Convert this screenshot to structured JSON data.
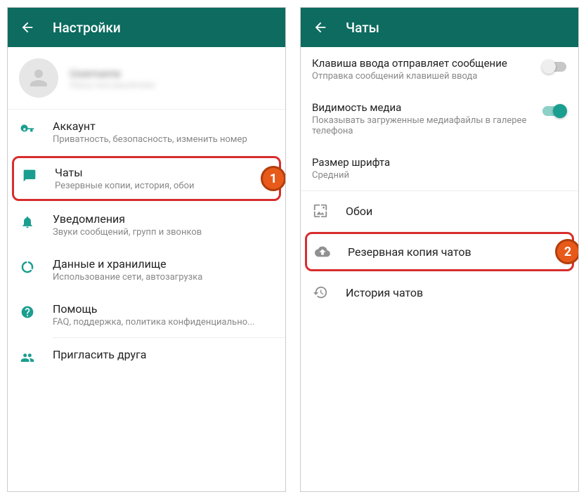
{
  "left": {
    "appbar_title": "Настройки",
    "profile": {
      "name": "Username",
      "status": "Status text placeholder"
    },
    "items": {
      "account": {
        "title": "Аккаунт",
        "sub": "Приватность, безопасность, изменить номер"
      },
      "chats": {
        "title": "Чаты",
        "sub": "Резервные копии, история, обои"
      },
      "notifications": {
        "title": "Уведомления",
        "sub": "Звуки сообщений, групп и звонков"
      },
      "data": {
        "title": "Данные и хранилище",
        "sub": "Использование сети, автозагрузка"
      },
      "help": {
        "title": "Помощь",
        "sub": "FAQ, поддержка, политика конфиденциально..."
      },
      "invite": {
        "title": "Пригласить друга"
      }
    },
    "badge": "1"
  },
  "right": {
    "appbar_title": "Чаты",
    "toggles": {
      "enter_send": {
        "title": "Клавиша ввода отправляет сообщение",
        "sub": "Отправка сообщений клавишей ввода"
      },
      "media_vis": {
        "title": "Видимость медиа",
        "sub": "Показывать загруженные медиафайлы в галерее телефона"
      }
    },
    "font_size": {
      "title": "Размер шрифта",
      "value": "Средний"
    },
    "rows": {
      "wallpaper": "Обои",
      "backup": "Резервная копия чатов",
      "history": "История чатов"
    },
    "badge": "2"
  }
}
